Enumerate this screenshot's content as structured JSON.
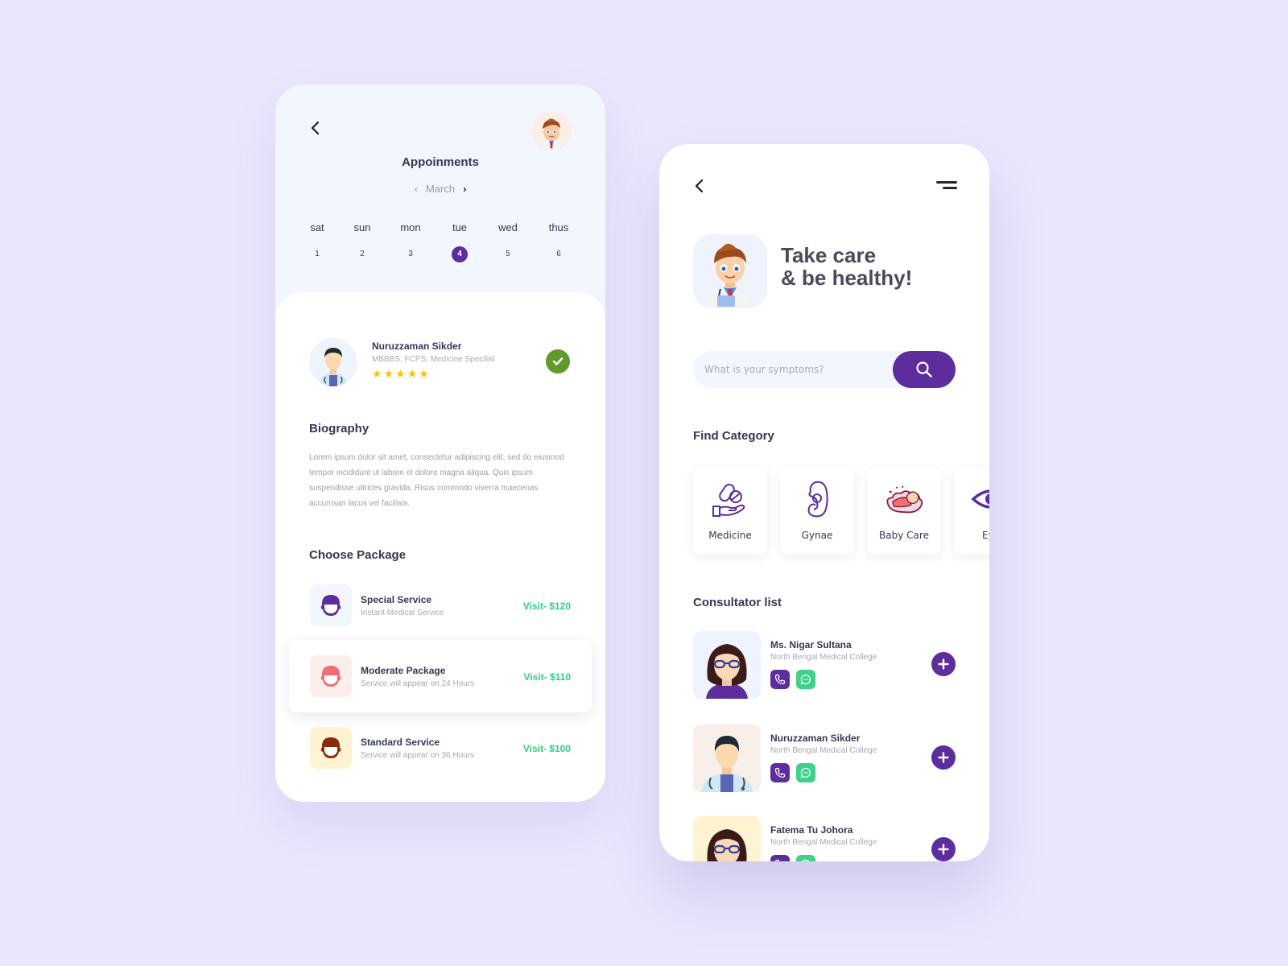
{
  "appointments_screen": {
    "title": "Appoinments",
    "month": "March",
    "days": [
      {
        "name": "sat",
        "num": "1"
      },
      {
        "name": "sun",
        "num": "2"
      },
      {
        "name": "mon",
        "num": "3"
      },
      {
        "name": "tue",
        "num": "4",
        "active": true
      },
      {
        "name": "wed",
        "num": "5"
      },
      {
        "name": "thus",
        "num": "6"
      }
    ],
    "doctor": {
      "name": "Nuruzzaman Sikder",
      "degrees": "MBBBS, FCPS, Medicine Specilist",
      "rating": 5,
      "rating_max": 5,
      "star_glyph": "★",
      "verified": true
    },
    "biography": {
      "title": "Biography",
      "text": "Lorem ipsum dolor sit amet, consectetur adipiscing elit, sed do eiusmod tempor incididunt ut labore et dolore magna aliqua. Quis ipsum suspendisse ultrices gravida. Risus commodo viverra maecenas accumsan lacus vel facilisis."
    },
    "packages": {
      "title": "Choose Package",
      "items": [
        {
          "title": "Special Service",
          "subtitle": "Instant Medical Service",
          "price": "Visit- $120",
          "icon": "doctor-head-icon",
          "icon_color": "#5d2d9e",
          "bg": "#f2f6ff",
          "selected": false
        },
        {
          "title": "Moderate Package",
          "subtitle": "Service will appear on 24 Hours",
          "price": "Visit- $110",
          "icon": "doctor-head-icon",
          "icon_color": "#ef6f74",
          "bg": "#fdeeee",
          "selected": true
        },
        {
          "title": "Standard Service",
          "subtitle": "Service will appear on 36 Hours",
          "price": "Visit- $100",
          "icon": "doctor-head-icon",
          "icon_color": "#8c2a0c",
          "bg": "#fff3d1",
          "selected": false
        }
      ]
    }
  },
  "home_screen": {
    "headline_line1": "Take care",
    "headline_line2": "& be healthy!",
    "search": {
      "placeholder": "What is your symptoms?",
      "value": ""
    },
    "categories": {
      "title": "Find Category",
      "items": [
        {
          "label": "Medicine",
          "icon": "pills-hand-icon"
        },
        {
          "label": "Gynae",
          "icon": "pregnancy-icon"
        },
        {
          "label": "Baby Care",
          "icon": "sleeping-baby-icon"
        },
        {
          "label": "Eye",
          "icon": "eye-icon"
        }
      ]
    },
    "consultators": {
      "title": "Consultator list",
      "items": [
        {
          "name": "Ms. Nigar Sultana",
          "college": "North Bengal Medical College",
          "avatar_bg": "#eef3fd"
        },
        {
          "name": "Nuruzzaman Sikder",
          "college": "North Bengal Medical College",
          "avatar_bg": "#f8efe8"
        },
        {
          "name": "Fatema Tu Johora",
          "college": "North Bengal Medical College",
          "avatar_bg": "#fff3d1"
        }
      ]
    }
  },
  "colors": {
    "background": "#e9e6fd",
    "primary": "#5d2d9e",
    "price_green": "#2ed184",
    "chat_green": "#3fd089",
    "verified_green": "#5e9b2c",
    "star": "#f8c40a"
  }
}
